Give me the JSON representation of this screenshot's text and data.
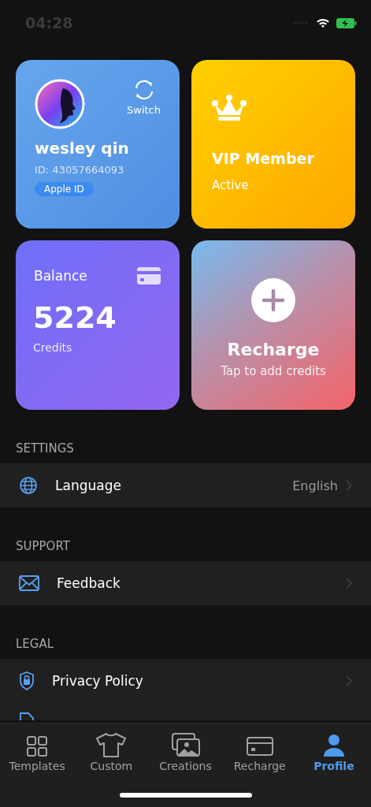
{
  "status_bar": {
    "time": "04:28"
  },
  "profile_card": {
    "name": "wesley qin",
    "id": "ID: 43057664093",
    "badge": "Apple ID",
    "switch_label": "Switch"
  },
  "vip_card": {
    "title": "VIP Member",
    "status": "Active"
  },
  "balance_card": {
    "label": "Balance",
    "amount": "5224",
    "unit": "Credits"
  },
  "recharge_card": {
    "title": "Recharge",
    "subtitle": "Tap to add credits"
  },
  "sections": [
    {
      "title": "SETTINGS",
      "items": [
        {
          "label": "Language",
          "value": "English"
        }
      ]
    },
    {
      "title": "SUPPORT",
      "items": [
        {
          "label": "Feedback"
        }
      ]
    },
    {
      "title": "LEGAL",
      "items": [
        {
          "label": "Privacy Policy"
        },
        {
          "kind": "partial"
        }
      ]
    }
  ],
  "tabs": [
    {
      "label": "Templates",
      "selected": false
    },
    {
      "label": "Custom",
      "selected": false
    },
    {
      "label": "Creations",
      "selected": false
    },
    {
      "label": "Recharge",
      "selected": false
    },
    {
      "label": "Profile",
      "selected": true
    }
  ]
}
